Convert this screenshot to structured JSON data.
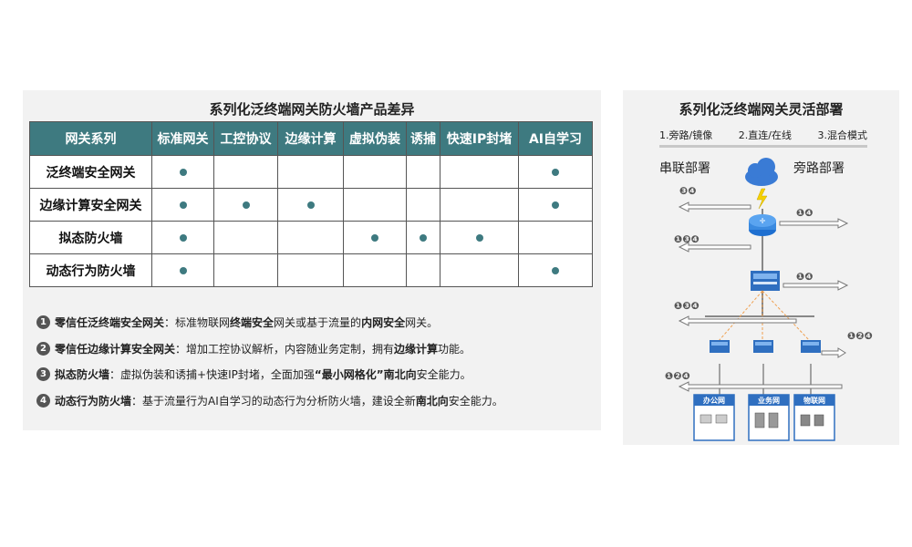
{
  "left": {
    "title": "系列化泛终端网关防火墙产品差异",
    "headers": [
      "网关系列",
      "标准网关",
      "工控协议",
      "边缘计算",
      "虚拟伪装",
      "诱捕",
      "快速IP封堵",
      "AI自学习"
    ],
    "rows": [
      {
        "name": "泛终端安全网关",
        "marks": [
          true,
          false,
          false,
          false,
          false,
          false,
          true
        ]
      },
      {
        "name": "边缘计算安全网关",
        "marks": [
          true,
          true,
          true,
          false,
          false,
          false,
          true
        ]
      },
      {
        "name": "拟态防火墙",
        "marks": [
          true,
          false,
          false,
          true,
          true,
          true,
          false
        ]
      },
      {
        "name": "动态行为防火墙",
        "marks": [
          true,
          false,
          false,
          false,
          false,
          false,
          true
        ]
      }
    ],
    "descriptions": [
      {
        "num": "1",
        "bold": "零信任泛终端安全网关",
        "p1": "：标准物联网",
        "b2": "终端安全",
        "p2": "网关或基于流量的",
        "b3": "内网安全",
        "p3": "网关。"
      },
      {
        "num": "2",
        "bold": "零信任边缘计算安全网关",
        "p1": "：增加工控协议解析，内容随业务定制，拥有",
        "b2": "边缘计算",
        "p2": "功能。",
        "b3": "",
        "p3": ""
      },
      {
        "num": "3",
        "bold": "拟态防火墙",
        "p1": "：虚拟伪装和诱捕+快速IP封堵，全面加强",
        "b2": "“最小网格化”南北向",
        "p2": "安全能力。",
        "b3": "",
        "p3": ""
      },
      {
        "num": "4",
        "bold": "动态行为防火墙",
        "p1": "：基于流量行为AI自学习的动态行为分析防火墙，建设全新",
        "b2": "南北向",
        "p2": "安全能力。",
        "b3": "",
        "p3": ""
      }
    ]
  },
  "right": {
    "title": "系列化泛终端网关灵活部署",
    "modes": [
      "1.旁路/镜像",
      "2.直连/在线",
      "3.混合模式"
    ],
    "serial_label": "串联部署",
    "bypass_label": "旁路部署",
    "arrow_tags": [
      "34",
      "14",
      "134",
      "14",
      "134",
      "124",
      "124"
    ],
    "networks": [
      "办公网",
      "业务网",
      "物联网"
    ]
  },
  "colors": {
    "header": "#3e7a80",
    "dot": "#3e7a80",
    "accent": "#3a7bd5",
    "orange": "#f0a050"
  }
}
